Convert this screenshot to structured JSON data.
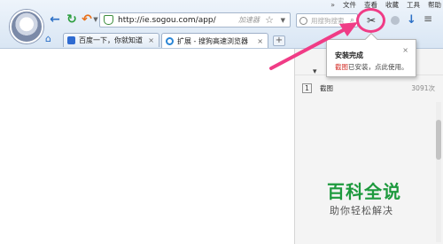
{
  "menubar": {
    "more": "»",
    "items": [
      "文件",
      "查看",
      "收藏",
      "工具",
      "帮助"
    ]
  },
  "address": {
    "url": "http://ie.sogou.com/app/",
    "accelerator": "加速器"
  },
  "search": {
    "placeholder": "用搜狗搜索"
  },
  "tabs": [
    {
      "label": "百度一下，你就知道"
    },
    {
      "label": "扩展 - 搜狗高速浏览器"
    }
  ],
  "new_tab_symbol": "+",
  "popup": {
    "title": "安装完成",
    "close": "×",
    "tag": "截图",
    "message": "已安装，点此使用。"
  },
  "sidebar": {
    "caret": "▾",
    "rows": [
      {
        "index": "1",
        "name": "截图",
        "size": "3091次"
      }
    ]
  },
  "watermark": {
    "title": "百科全说",
    "subtitle": "助你轻松解决"
  },
  "colors": {
    "highlight": "#f03c86",
    "watermark_green": "#1e9a3e"
  }
}
